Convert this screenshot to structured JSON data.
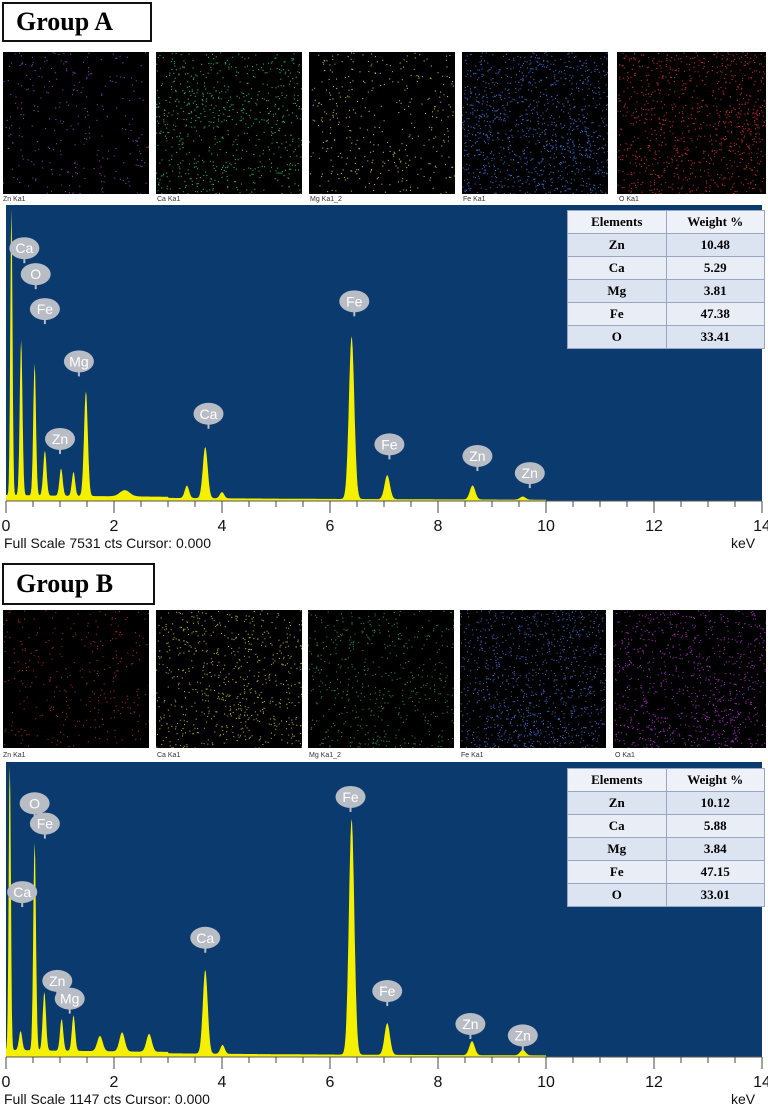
{
  "panels": [
    {
      "title": "Group A",
      "maps": [
        {
          "label": "Zn Ka1",
          "color": "#9b46d8",
          "density": 0.04
        },
        {
          "label": "Ca Ka1",
          "color": "#2ec775",
          "density": 0.3
        },
        {
          "label": "Mg Ka1_2",
          "color": "#d6d235",
          "density": 0.1
        },
        {
          "label": "Fe Ka1",
          "color": "#3b7ae8",
          "density": 0.55
        },
        {
          "label": "O Ka1",
          "color": "#e42f2f",
          "density": 0.45
        }
      ],
      "table": {
        "headers": [
          "Elements",
          "Weight %"
        ],
        "rows": [
          [
            "Zn",
            "10.48"
          ],
          [
            "Ca",
            "5.29"
          ],
          [
            "Mg",
            "3.81"
          ],
          [
            "Fe",
            "47.38"
          ],
          [
            "O",
            "33.41"
          ]
        ]
      },
      "footer": "Full Scale 7531 cts Cursor: 0.000",
      "unit": "keV"
    },
    {
      "title": "Group B",
      "maps": [
        {
          "label": "Zn Ka1",
          "color": "#cc2a2a",
          "density": 0.06
        },
        {
          "label": "Ca Ka1",
          "color": "#c9c532",
          "density": 0.28
        },
        {
          "label": "Mg Ka1_2",
          "color": "#29a35e",
          "density": 0.2
        },
        {
          "label": "Fe Ka1",
          "color": "#3b74e0",
          "density": 0.5
        },
        {
          "label": "O Ka1",
          "color": "#b12ed3",
          "density": 0.42
        }
      ],
      "table": {
        "headers": [
          "Elements",
          "Weight %"
        ],
        "rows": [
          [
            "Zn",
            "10.12"
          ],
          [
            "Ca",
            "5.88"
          ],
          [
            "Mg",
            "3.84"
          ],
          [
            "Fe",
            "47.15"
          ],
          [
            "O",
            "33.01"
          ]
        ]
      },
      "footer": "Full Scale 1147 cts Cursor: 0.000",
      "unit": "keV"
    }
  ],
  "chart_data": [
    {
      "type": "line",
      "title": "",
      "xlabel": "keV",
      "ylabel": "",
      "xlim": [
        0,
        14
      ],
      "ylim": [
        0,
        7531
      ],
      "xticks": [
        0,
        2,
        4,
        6,
        8,
        10,
        12,
        14
      ],
      "full_scale_cts": 7531,
      "peaks": [
        {
          "x": 0.1,
          "y": 7531,
          "w": 0.02
        },
        {
          "x": 0.28,
          "y": 4000,
          "w": 0.025
        },
        {
          "x": 0.53,
          "y": 3400,
          "w": 0.025
        },
        {
          "x": 0.72,
          "y": 1150,
          "w": 0.03
        },
        {
          "x": 1.02,
          "y": 700,
          "w": 0.03
        },
        {
          "x": 1.25,
          "y": 620,
          "w": 0.03
        },
        {
          "x": 1.48,
          "y": 2700,
          "w": 0.035
        },
        {
          "x": 2.2,
          "y": 160,
          "w": 0.09
        },
        {
          "x": 3.35,
          "y": 320,
          "w": 0.04
        },
        {
          "x": 3.69,
          "y": 1320,
          "w": 0.045
        },
        {
          "x": 4.0,
          "y": 160,
          "w": 0.04
        },
        {
          "x": 6.4,
          "y": 4200,
          "w": 0.05
        },
        {
          "x": 7.06,
          "y": 620,
          "w": 0.05
        },
        {
          "x": 8.64,
          "y": 360,
          "w": 0.05
        },
        {
          "x": 9.57,
          "y": 80,
          "w": 0.05
        }
      ],
      "background_cts": 110,
      "annotations": [
        {
          "text": "Ca",
          "x": 0.34,
          "y": 6520
        },
        {
          "text": "O",
          "x": 0.55,
          "y": 5850
        },
        {
          "text": "Fe",
          "x": 0.72,
          "y": 4950
        },
        {
          "text": "Mg",
          "x": 1.35,
          "y": 3600
        },
        {
          "text": "Zn",
          "x": 1.0,
          "y": 1600
        },
        {
          "text": "Ca",
          "x": 3.75,
          "y": 2250
        },
        {
          "text": "Fe",
          "x": 6.45,
          "y": 5150
        },
        {
          "text": "Fe",
          "x": 7.1,
          "y": 1460
        },
        {
          "text": "Zn",
          "x": 8.73,
          "y": 1160
        },
        {
          "text": "Zn",
          "x": 9.7,
          "y": 720
        }
      ]
    },
    {
      "type": "line",
      "title": "",
      "xlabel": "keV",
      "ylabel": "",
      "xlim": [
        0,
        14
      ],
      "ylim": [
        0,
        1147
      ],
      "xticks": [
        0,
        2,
        4,
        6,
        8,
        10,
        12,
        14
      ],
      "full_scale_cts": 1147,
      "peaks": [
        {
          "x": 0.07,
          "y": 1147,
          "w": 0.02
        },
        {
          "x": 0.27,
          "y": 75,
          "w": 0.03
        },
        {
          "x": 0.53,
          "y": 820,
          "w": 0.025
        },
        {
          "x": 0.71,
          "y": 230,
          "w": 0.03
        },
        {
          "x": 1.03,
          "y": 125,
          "w": 0.03
        },
        {
          "x": 1.25,
          "y": 140,
          "w": 0.03
        },
        {
          "x": 1.74,
          "y": 60,
          "w": 0.05
        },
        {
          "x": 2.15,
          "y": 75,
          "w": 0.05
        },
        {
          "x": 2.65,
          "y": 70,
          "w": 0.05
        },
        {
          "x": 3.69,
          "y": 330,
          "w": 0.045
        },
        {
          "x": 4.01,
          "y": 35,
          "w": 0.04
        },
        {
          "x": 6.4,
          "y": 930,
          "w": 0.05
        },
        {
          "x": 7.06,
          "y": 125,
          "w": 0.05
        },
        {
          "x": 8.63,
          "y": 55,
          "w": 0.05
        },
        {
          "x": 9.57,
          "y": 22,
          "w": 0.05
        }
      ],
      "background_cts": 20,
      "annotations": [
        {
          "text": "O",
          "x": 0.53,
          "y": 1000
        },
        {
          "text": "Fe",
          "x": 0.72,
          "y": 920
        },
        {
          "text": "Ca",
          "x": 0.3,
          "y": 650
        },
        {
          "text": "Zn",
          "x": 0.95,
          "y": 300
        },
        {
          "text": "Mg",
          "x": 1.18,
          "y": 230
        },
        {
          "text": "Ca",
          "x": 3.69,
          "y": 470
        },
        {
          "text": "Fe",
          "x": 6.38,
          "y": 1025
        },
        {
          "text": "Fe",
          "x": 7.06,
          "y": 260
        },
        {
          "text": "Zn",
          "x": 8.6,
          "y": 130
        },
        {
          "text": "Zn",
          "x": 9.57,
          "y": 85
        }
      ]
    }
  ]
}
